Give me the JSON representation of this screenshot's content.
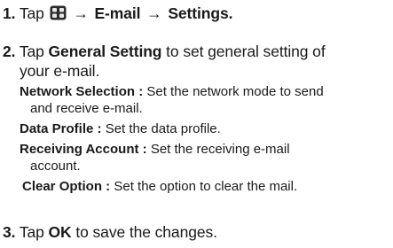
{
  "steps": {
    "s1": {
      "num": "1.",
      "tap": "Tap",
      "arrow1": "→",
      "email": "E-mail",
      "arrow2": "→",
      "settings": "Settings."
    },
    "s2": {
      "num": "2.",
      "tap": "Tap",
      "general": "General Setting",
      "rest1": "to set general setting of",
      "rest2": "your e-mail."
    },
    "s3": {
      "num": "3.",
      "tap": "Tap",
      "ok": "OK",
      "rest": "to save the changes."
    }
  },
  "options": {
    "network": {
      "label": "Network Selection :",
      "line1": "Set the network mode to send",
      "line2": "and receive e-mail."
    },
    "data_profile": {
      "label": "Data Profile :",
      "line1": "Set the data profile."
    },
    "receiving": {
      "label": "Receiving Account :",
      "line1": "Set the receiving e-mail",
      "line2": "account."
    },
    "clear": {
      "label": "Clear Option :",
      "line1": "Set the option to clear the mail."
    }
  },
  "icons": {
    "apps": "apps-grid-icon"
  }
}
